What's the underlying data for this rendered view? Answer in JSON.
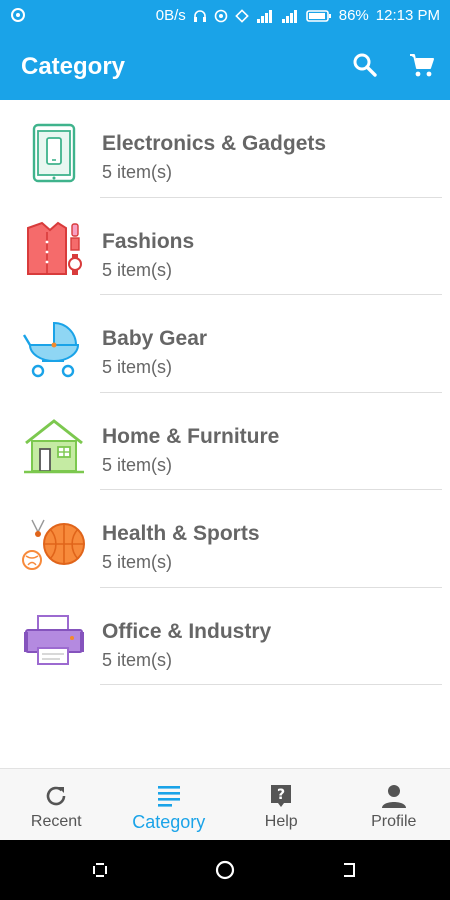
{
  "status_bar": {
    "speed": "0B/s",
    "battery": "86%",
    "time": "12:13 PM"
  },
  "app_bar": {
    "title": "Category",
    "search_icon": "search-icon",
    "cart_icon": "cart-icon"
  },
  "categories": [
    {
      "name": "Electronics & Gadgets",
      "count": "5 item(s)",
      "icon": "tablet-icon"
    },
    {
      "name": "Fashions",
      "count": "5 item(s)",
      "icon": "shirt-icon"
    },
    {
      "name": "Baby Gear",
      "count": "5 item(s)",
      "icon": "stroller-icon"
    },
    {
      "name": "Home & Furniture",
      "count": "5 item(s)",
      "icon": "house-icon"
    },
    {
      "name": "Health & Sports",
      "count": "5 item(s)",
      "icon": "sports-ball-icon"
    },
    {
      "name": "Office & Industry",
      "count": "5 item(s)",
      "icon": "printer-icon"
    }
  ],
  "bottom_nav": [
    {
      "label": "Recent",
      "icon": "refresh-icon"
    },
    {
      "label": "Category",
      "icon": "list-icon",
      "active": true
    },
    {
      "label": "Help",
      "icon": "help-icon"
    },
    {
      "label": "Profile",
      "icon": "person-icon"
    }
  ],
  "colors": {
    "primary": "#1aa3e8",
    "text": "#666666"
  }
}
